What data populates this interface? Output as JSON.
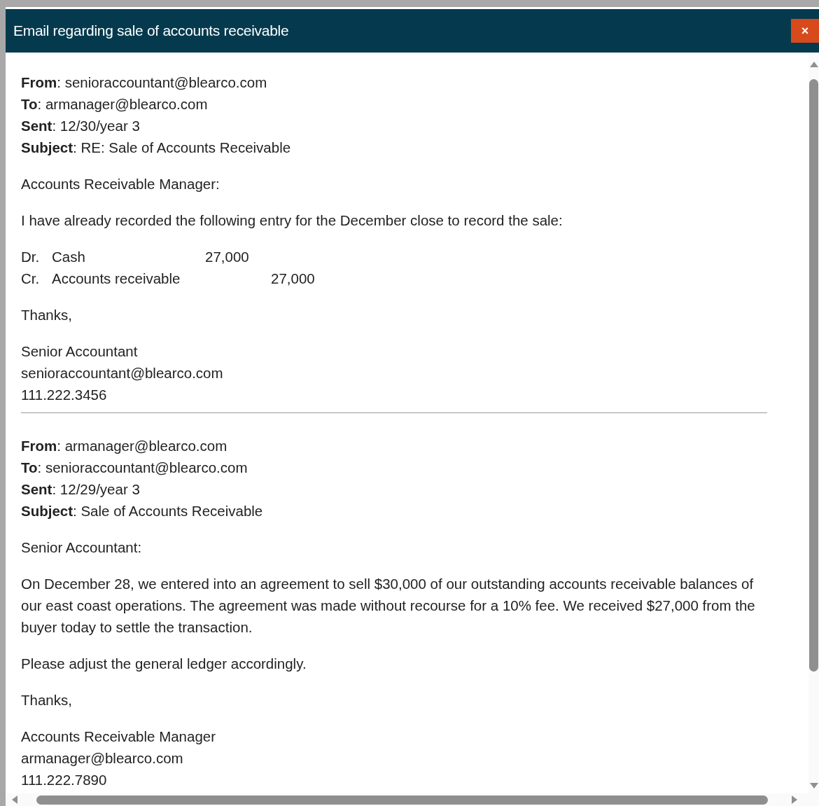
{
  "window": {
    "title": "Email regarding sale of accounts receivable",
    "close": "×"
  },
  "emails": [
    {
      "headers": [
        "**From**: senioraccountant@blearco.com",
        "**To**: armanager@blearco.com",
        "**Sent**: 12/30/year 3",
        "**Subject**: RE: Sale of Accounts Receivable"
      ],
      "blocks": [
        {
          "kind": "paragraph",
          "text": "Accounts Receivable Manager:"
        },
        {
          "kind": "paragraph",
          "text": "I have already recorded the following entry for the December close to record the sale:"
        },
        {
          "kind": "journal",
          "lines": [
            {
              "side": "Dr.",
              "account": "Cash",
              "debit": "27,000"
            },
            {
              "side": "Cr.",
              "account": "Accounts receivable",
              "credit": "27,000"
            }
          ]
        },
        {
          "kind": "paragraph",
          "text": "Thanks,"
        },
        {
          "kind": "signature",
          "lines": [
            "Senior Accountant",
            "senioraccountant@blearco.com",
            "111.222.3456"
          ]
        }
      ]
    },
    {
      "headers": [
        "**From**: armanager@blearco.com",
        "**To**: senioraccountant@blearco.com",
        "**Sent**: 12/29/year 3",
        "**Subject**: Sale of Accounts Receivable"
      ],
      "blocks": [
        {
          "kind": "paragraph",
          "text": "Senior Accountant:"
        },
        {
          "kind": "paragraph",
          "text": "On December 28, we entered into an agreement to sell $30,000 of our outstanding accounts receivable balances of our east coast operations. The agreement was made without recourse for a 10% fee. We received $27,000 from the buyer today to settle the transaction."
        },
        {
          "kind": "paragraph",
          "text": "Please adjust the general ledger accordingly."
        },
        {
          "kind": "paragraph",
          "text": "Thanks,"
        },
        {
          "kind": "signature",
          "lines": [
            "Accounts Receivable Manager",
            "armanager@blearco.com",
            "111.222.7890"
          ]
        }
      ]
    }
  ]
}
